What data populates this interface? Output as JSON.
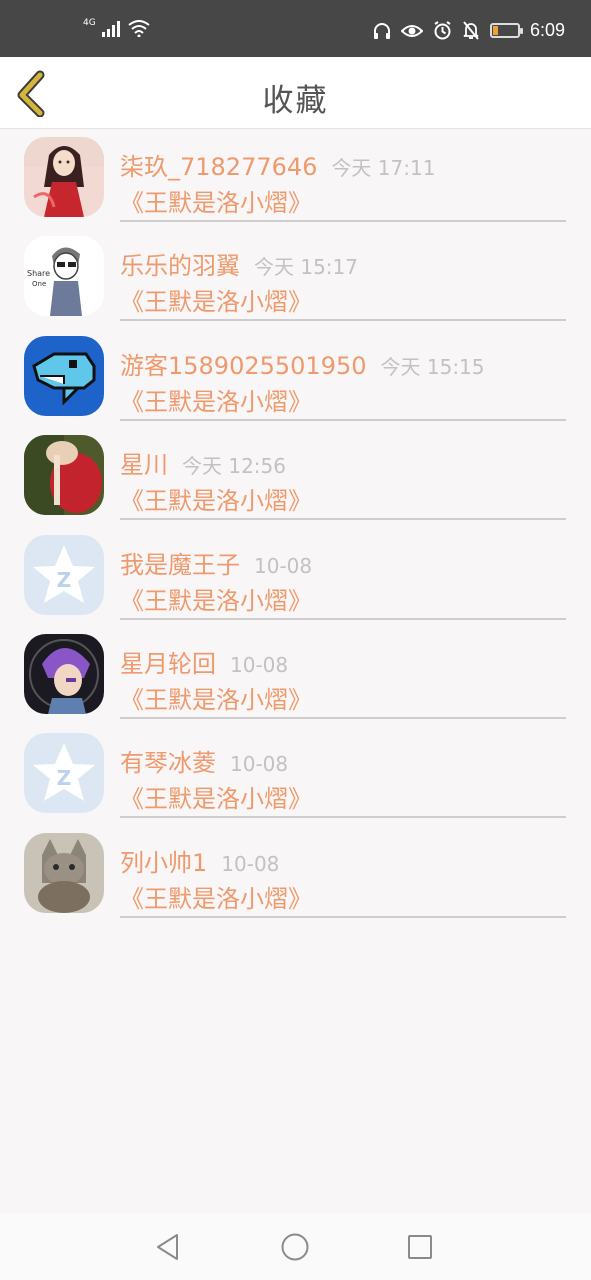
{
  "status_bar": {
    "network": "4G",
    "time": "6:09",
    "battery_level": 0.18,
    "battery_color": "#f0a23a"
  },
  "header": {
    "title": "收藏"
  },
  "accent_color": "#ef9a6c",
  "list": [
    {
      "name": "柒玖_718277646",
      "time": "今天 17:11",
      "book": "《王默是洛小熠》",
      "avatar": "anime-girl-red"
    },
    {
      "name": "乐乐的羽翼",
      "time": "今天 15:17",
      "book": "《王默是洛小熠》",
      "avatar": "share-boy-sketch"
    },
    {
      "name": "游客1589025501950",
      "time": "今天 15:15",
      "book": "《王默是洛小熠》",
      "avatar": "pixel-dolphin"
    },
    {
      "name": "星川",
      "time": "今天 12:56",
      "book": "《王默是洛小熠》",
      "avatar": "red-flower-photo"
    },
    {
      "name": "我是魔王子",
      "time": "10-08",
      "book": "《王默是洛小熠》",
      "avatar": "default-star-z"
    },
    {
      "name": "星月轮回",
      "time": "10-08",
      "book": "《王默是洛小熠》",
      "avatar": "purple-hair-anime"
    },
    {
      "name": "有琴冰菱",
      "time": "10-08",
      "book": "《王默是洛小熠》",
      "avatar": "default-star-z"
    },
    {
      "name": "列小帅1",
      "time": "10-08",
      "book": "《王默是洛小熠》",
      "avatar": "cat-photo"
    }
  ]
}
